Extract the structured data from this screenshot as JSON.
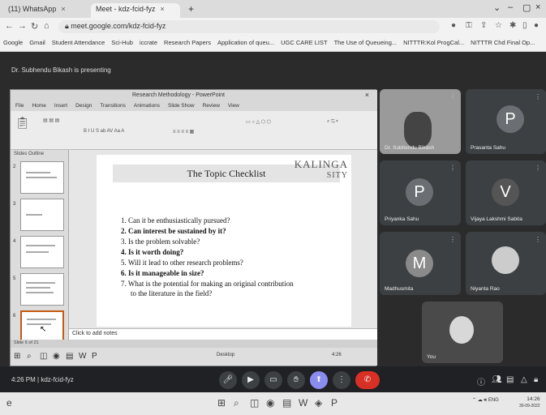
{
  "browser": {
    "tabs": [
      {
        "label": "(11) WhatsApp"
      },
      {
        "label": "Meet - kdz-fcid-fyz"
      },
      {
        "label": ""
      }
    ],
    "url": "meet.google.com/kdz-fcid-fyz",
    "bookmarks": [
      "Google",
      "Gmail",
      "Student Attendance",
      "Sci-Hub",
      "iccrate",
      "Research Papers",
      "Application of queu...",
      "UGC CARE LIST",
      "The Use of Queueing...",
      "NITTTR:Kol ProgCal...",
      "NITTTR Chd Final Op..."
    ]
  },
  "meet": {
    "presenting_label": "Dr. Subhendu Bikash is presenting",
    "meeting_time": "4:26 PM",
    "meeting_code": "kdz-fcid-fyz",
    "participants": [
      {
        "name": "Dr. Subhendu Bikash",
        "initial": "",
        "color": "#5a5f63"
      },
      {
        "name": "Prasanta Sahu",
        "initial": "P",
        "color": "#5f6368"
      },
      {
        "name": "Priyanka Sahu",
        "initial": "P",
        "color": "#4a5560"
      },
      {
        "name": "Vijaya Lakshmi Sabita",
        "initial": "V",
        "color": "#4f4f4f"
      },
      {
        "name": "Madhusmita",
        "initial": "M",
        "color": "#6e6e6e"
      },
      {
        "name": "Niyanta Rao",
        "initial": "",
        "color": "#6a6a6a"
      },
      {
        "name": "You",
        "initial": "",
        "color": "#7a7a7a"
      }
    ]
  },
  "ppt": {
    "window_title": "Research Methodology - PowerPoint",
    "menu": [
      "File",
      "Home",
      "Insert",
      "Design",
      "Transitions",
      "Animations",
      "Slide Show",
      "Review",
      "View"
    ],
    "thumbs_header": "Slides",
    "outline_label": "Outline",
    "slide_title": "The Topic Checklist",
    "logo_line1": "KALINGA",
    "logo_line2": "SITY",
    "items": [
      {
        "n": "1.",
        "text": "Can it be enthusiastically pursued?",
        "bold": false
      },
      {
        "n": "2.",
        "text": "Can interest be sustained by it?",
        "bold": true
      },
      {
        "n": "3.",
        "text": "Is the problem solvable?",
        "bold": false
      },
      {
        "n": "4.",
        "text": "Is it worth doing?",
        "bold": true
      },
      {
        "n": "5.",
        "text": "Will it lead to other research problems?",
        "bold": false
      },
      {
        "n": "6.",
        "text": "Is it manageable in size?",
        "bold": true
      },
      {
        "n": "7.",
        "text": "What is the potential for making an original contribution",
        "bold": false
      }
    ],
    "item7_cont": "to the literature in the field?",
    "notes_placeholder": "Click to add notes",
    "status": "Slide 6 of 21",
    "taskbar_label": "Desktop",
    "inner_time": "4:26"
  },
  "windows": {
    "time": "14:26",
    "date": "30-09-2022",
    "lang": "ENG"
  }
}
